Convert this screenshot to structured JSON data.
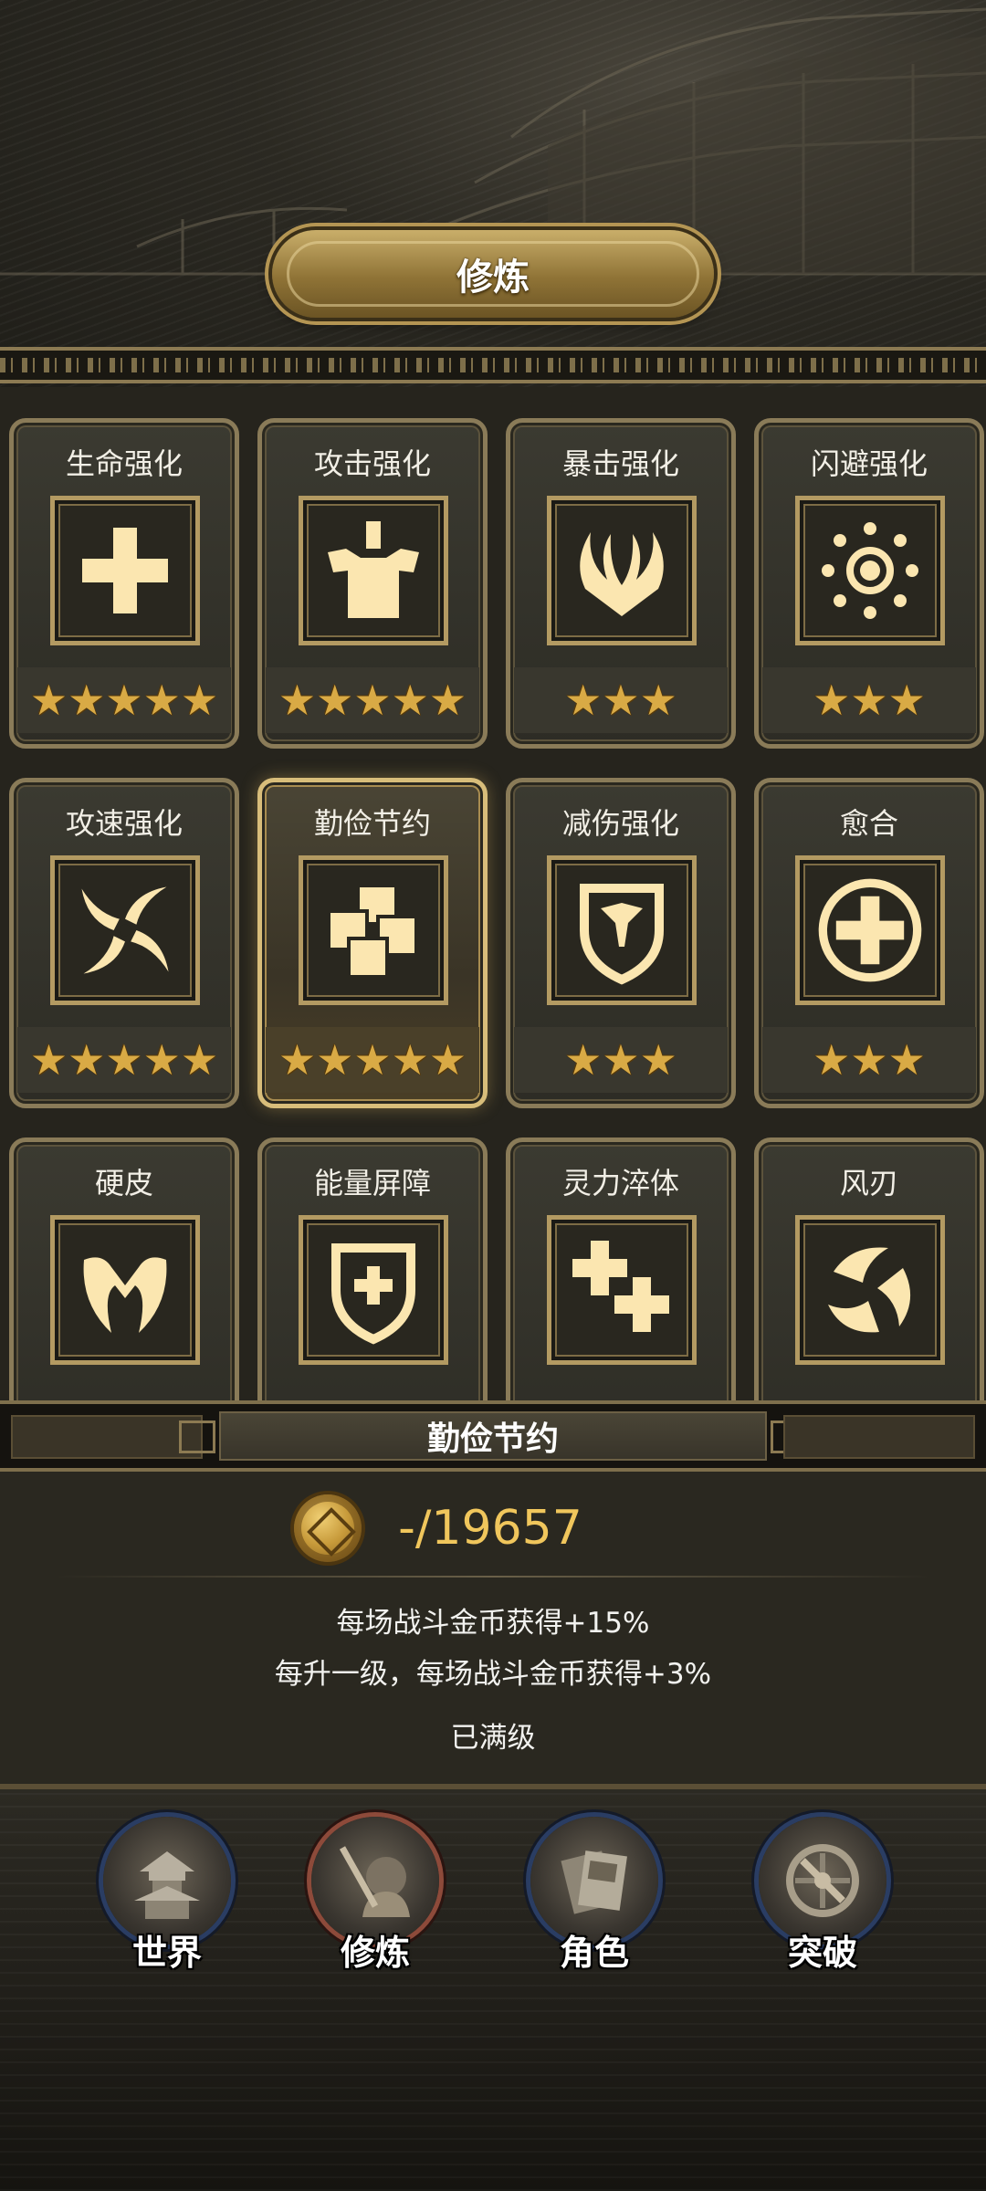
{
  "header": {
    "title": "修炼"
  },
  "cards": [
    {
      "name": "生命强化",
      "icon": "plus-icon",
      "stars": 5
    },
    {
      "name": "攻击强化",
      "icon": "armor-icon",
      "stars": 5
    },
    {
      "name": "暴击强化",
      "icon": "claw-icon",
      "stars": 3
    },
    {
      "name": "闪避强化",
      "icon": "sun-icon",
      "stars": 3
    },
    {
      "name": "攻速强化",
      "icon": "shuriken-icon",
      "stars": 5
    },
    {
      "name": "勤俭节约",
      "icon": "coins-stack-icon",
      "stars": 5,
      "selected": true
    },
    {
      "name": "减伤强化",
      "icon": "shield-icon",
      "stars": 3
    },
    {
      "name": "愈合",
      "icon": "circle-plus-icon",
      "stars": 3
    },
    {
      "name": "硬皮",
      "icon": "helmet-icon",
      "stars": 0
    },
    {
      "name": "能量屏障",
      "icon": "shield-plus-icon",
      "stars": 0
    },
    {
      "name": "灵力淬体",
      "icon": "double-plus-icon",
      "stars": 0
    },
    {
      "name": "风刃",
      "icon": "blades-icon",
      "stars": 0
    }
  ],
  "detail": {
    "title": "勤俭节约",
    "cost": "-/19657",
    "desc1": "每场战斗金币获得+15%",
    "desc2": "每升一级，每场战斗金币获得+3%",
    "status": "已满级"
  },
  "nav": [
    {
      "label": "世界",
      "icon": "pagoda-icon"
    },
    {
      "label": "修炼",
      "icon": "warrior-icon",
      "active": true
    },
    {
      "label": "角色",
      "icon": "cards-icon"
    },
    {
      "label": "突破",
      "icon": "compass-icon"
    }
  ],
  "colors": {
    "gold": "#d9aa45",
    "cardBorder": "#8a7b58",
    "glyph": "#fbe6b0"
  }
}
